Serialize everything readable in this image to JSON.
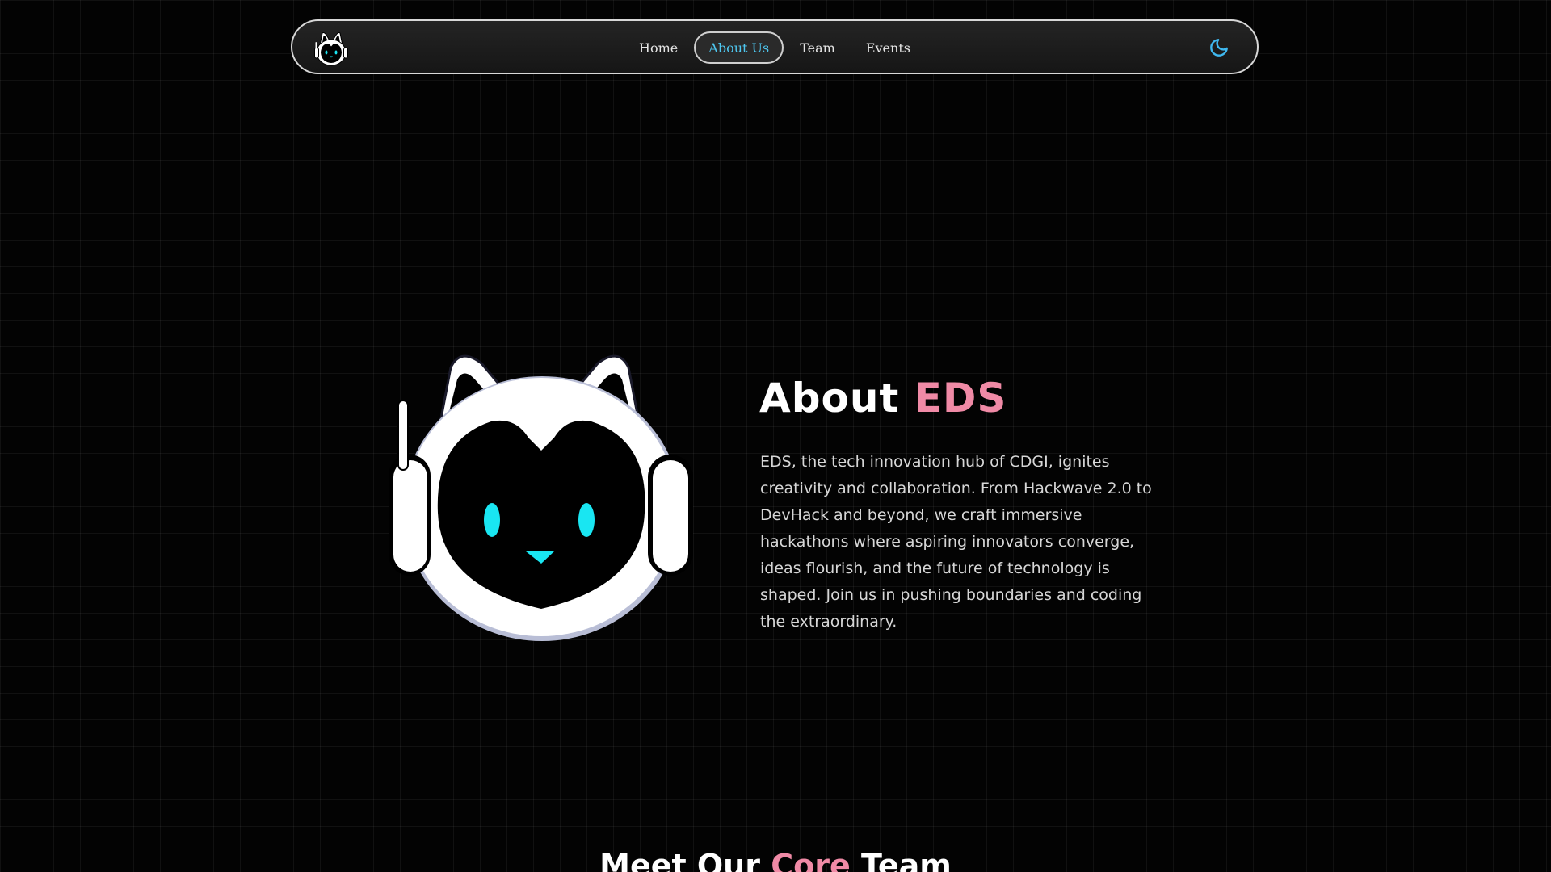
{
  "navbar": {
    "logo_icon": "eds-cat-robot-logo",
    "links": [
      {
        "label": "Home",
        "active": false
      },
      {
        "label": "About Us",
        "active": true
      },
      {
        "label": "Team",
        "active": false
      },
      {
        "label": "Events",
        "active": false
      }
    ],
    "theme_toggle_icon": "moon-icon",
    "active_color": "#4ec7f0"
  },
  "about": {
    "mascot_icon": "eds-cat-robot-mascot",
    "title_prefix": "About ",
    "title_accent": "EDS",
    "accent_color": "#f08aa6",
    "body": "EDS, the tech innovation hub of CDGI, ignites creativity and collaboration. From Hackwave 2.0 to DevHack and beyond, we craft immersive hackathons where aspiring innovators converge, ideas flourish, and the future of technology is shaped. Join us in pushing boundaries and coding the extraordinary."
  },
  "team": {
    "title_prefix": "Meet Our ",
    "title_accent": "Core",
    "title_suffix": " Team"
  }
}
